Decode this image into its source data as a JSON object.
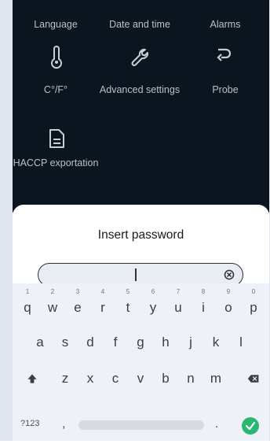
{
  "menu": {
    "top_row": [
      "Language",
      "Date and time",
      "Alarms"
    ],
    "tiles": [
      {
        "label": "C°/F°",
        "icon": "thermometer-icon"
      },
      {
        "label": "Advanced settings",
        "icon": "wrench-icon"
      },
      {
        "label": "Probe",
        "icon": "probe-icon"
      },
      {
        "label": "HACCP exportation",
        "icon": "document-icon"
      }
    ]
  },
  "dialog": {
    "title": "Insert password",
    "input_value": ""
  },
  "keyboard": {
    "row1": [
      {
        "key": "q",
        "hint": "1"
      },
      {
        "key": "w",
        "hint": "2"
      },
      {
        "key": "e",
        "hint": "3"
      },
      {
        "key": "r",
        "hint": "4"
      },
      {
        "key": "t",
        "hint": "5"
      },
      {
        "key": "y",
        "hint": "6"
      },
      {
        "key": "u",
        "hint": "7"
      },
      {
        "key": "i",
        "hint": "8"
      },
      {
        "key": "o",
        "hint": "9"
      },
      {
        "key": "p",
        "hint": "0"
      }
    ],
    "row2": [
      "a",
      "s",
      "d",
      "f",
      "g",
      "h",
      "j",
      "k",
      "l"
    ],
    "row3": [
      "z",
      "x",
      "c",
      "v",
      "b",
      "n",
      "m"
    ],
    "bottom": {
      "symbols": "?123",
      "comma": ",",
      "period": "."
    }
  },
  "colors": {
    "app_bg": "#0b1520",
    "enter": "#2bb673",
    "sidebar": "#e2e6ef"
  }
}
